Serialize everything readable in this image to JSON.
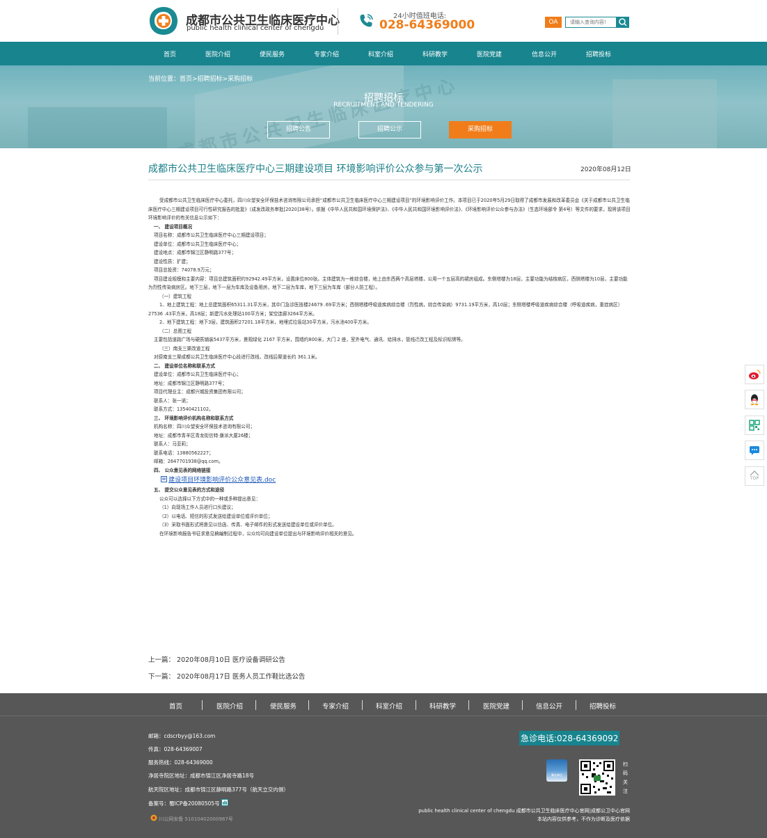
{
  "header": {
    "logo_cn": "成都市公共卫生临床医疗中心",
    "logo_en": "public health clinical center of chengdu",
    "hotline_label": "24小时值班电话:",
    "hotline_number": "028-64369000",
    "oa_label": "OA",
    "search_placeholder": "请输入查询内容!"
  },
  "nav": {
    "items": [
      "首页",
      "医院介绍",
      "便民服务",
      "专家介绍",
      "科室介绍",
      "科研教学",
      "医院党建",
      "信息公开",
      "招聘投标"
    ]
  },
  "banner": {
    "breadcrumb": "当前位置：首页>招聘招标>采购招标",
    "title": "招聘招标",
    "subtitle": "RECRUITMENT AND TENDERING",
    "watermark": "成都市公共卫生临床医疗中心",
    "tabs": [
      "招聘公告",
      "招聘公示",
      "采购招标"
    ]
  },
  "article": {
    "title": "成都市公共卫生临床医疗中心三期建设项目 环境影响评价公众参与第一次公示",
    "date": "2020年08月12日",
    "intro": "受成都市公共卫生临床医疗中心委托，四川众望安全环保技术咨询有限公司承担“成都市公共卫生临床医疗中心三期建设项目”的环境影响评价工作。本项目已于2020年5月29日取得了成都市发展和改革委员会《关于成都市公共卫生临床医疗中心三期建设项目可行性研究报告的批复》（成发改政务审批[2020]38号）。依据《中华人民共和国环境保护法》、《中华人民共和国环境影响评价法》、《环境影响评价公众参与办法》（生态环境部令 第4号）等文件的要求，现将该项目环境影响评价的有关信息公示如下：",
    "s1_title": "一、 建设项目概况",
    "s1_lines": [
      "项目名称：成都市公共卫生临床医疗中心三期建设项目；",
      "建设单位：成都市公共卫生临床医疗中心；",
      "建设地点：成都市锦江区静明路377号；",
      "建设性质：扩建；",
      "项目总投资：74078.9万元；"
    ],
    "scale": "项目建设规模和主要内容：项目总建筑面积约92942.49平方米，设置床位800张。主体建筑为一栋综合楼，地上由东西两个高层塔楼，公用一个五层高的裙房组成。东侧塔楼为18层，主要功能为结核病区，西侧塔楼为10层，主要功能为烈性传染病房区。地下三层，地下一层为车库及设备用房，地下二层为车库，地下三层为车库（部分人防工程）。",
    "sub1": "（一）建筑工程",
    "sub1_a": "1、地上建筑工程：地上总建筑面积65311.31平方米，其中门急诊医技楼24679 .69平方米；西侧塔楼呼吸道疾病综合楼（烈性病，综合传染病）9731.19平方米，高10层；东侧塔楼呼吸道疾病综合楼（呼吸道疾病，重症病区）27536 .43平方米，高18层；新建污水处理站100平方米；架空连廊3264平方米。",
    "sub1_b": "2、地下建筑工程：地下3层，建筑面积27201.18平方米，地埋式垃圾站30平方米，污水池400平方米。",
    "sub2": "（二）总图工程",
    "sub2_text": "主要包括道路广场与硬质铺装5437平方米，景观绿化 2167 平方米，围墙约800米，大门 2 座，室外电气、通讯、给排水，管线迁改工程及标识标牌等。",
    "sub3": "（三）南支三渠改道工程",
    "sub3_text": "对原南支三渠成都公共卫生临床医疗中心段进行改线，改线后渠道长约 361.1米。",
    "s2_title": "二、 建设单位名称和联系方式",
    "s2_lines": [
      "建设单位：成都市公共卫生临床医疗中心；",
      "地址：成都市锦江区静明路377号；",
      "项目代理业主：成都兴城投资集团有限公司；",
      "联系人：张一诺；",
      "联系方式：13540421102。"
    ],
    "s3_title": "三、 环境影响评价机构名称和联系方式",
    "s3_lines": [
      "机构名称：四川众望安全环保技术咨询有限公司；",
      "地址：成都市青羊区青龙街信特·康派大厦26楼；",
      "联系人：马亚莉；",
      "联系电话：13880562227；",
      "邮箱：2647701938@qq.com。"
    ],
    "s4_title": "四、 公众意见表的网络链接",
    "doc_link": "建设项目环境影响评价公众意见表.doc",
    "s5_title": "五、 提交公众意见表的方式和途径",
    "s5_lines": [
      "公众可以选择以下方式中的一种或多种提出意见：",
      "（1）向现场工作人员进行口头建议；",
      "（2）以电话、短信的形式发送给建设单位或评价单位；",
      "（3）采取书面形式将意见以信函、传真、电子邮件的形式发送给建设单位或评价单位。",
      "在环境影响报告书征求意见稿编制过程中，公众均可向建设单位提出与环境影响评价相关的意见。"
    ],
    "prev": "上一篇： 2020年08月10日 医疗设备调研公告",
    "next": "下一篇： 2020年08月17日 医务人员工作鞋比选公告"
  },
  "footer": {
    "nav": [
      "首页",
      "医院介绍",
      "便民服务",
      "专家介绍",
      "科室介绍",
      "科研教学",
      "医院党建",
      "信息公开",
      "招聘投标"
    ],
    "email": "邮箱：cdscrbyy@163.com",
    "fax": "传真：028-64369007",
    "service": "服务热线：028-64369000",
    "addr1": "净居寺院区地址：成都市锦江区净居寺路18号",
    "addr2": "航天院区地址：成都市锦江区静明路377号（航天立交内侧）",
    "icp": "备案号：蜀ICP备20080505号",
    "police": "川公网安备 51010402000987号",
    "emergency": "急诊电话:028-64369092",
    "badge_label": "事业单位",
    "qr_text": "扫码关注",
    "en_line": "public health clinical center of chengdu 成都市公共卫生临床医疗中心官网|成都公卫中心官网",
    "note": "本站内容仅供参考，不作为诊断及医疗依据"
  },
  "side_toolbar": {
    "top_label": "TOP"
  },
  "colors": {
    "brand": "#17848e",
    "accent": "#f07d1a",
    "footer_bg": "#575757"
  }
}
